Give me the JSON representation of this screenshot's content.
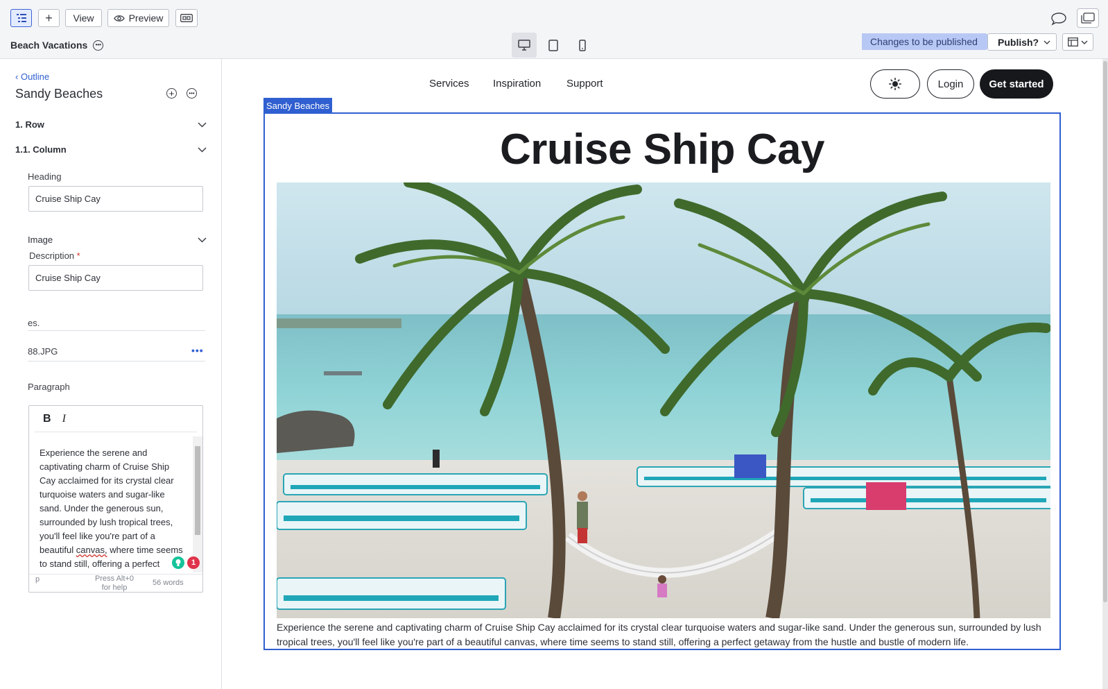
{
  "toolbar": {
    "view_label": "View",
    "preview_label": "Preview"
  },
  "site": {
    "title": "Beach Vacations"
  },
  "publish": {
    "status": "Changes to be published",
    "button_label": "Publish?"
  },
  "outline": {
    "back_label": "Outline",
    "title": "Sandy Beaches",
    "sections": [
      {
        "label": "1. Row"
      },
      {
        "label": "1.1. Column"
      }
    ]
  },
  "fields": {
    "heading_label": "Heading",
    "heading_value": "Cruise Ship Cay",
    "image_label": "Image",
    "description_label": "Description",
    "description_required": "*",
    "description_value": "Cruise Ship Cay",
    "images_partial": "‍es.",
    "file_name": "88.JPG",
    "file_more": "•••",
    "paragraph_label": "Paragraph",
    "bold_label": "B",
    "italic_label": "I",
    "paragraph_text_before": "Experience the serene and captivating charm of Cruise Ship Cay acclaimed for its crystal clear turquoise waters and sugar-like sand. Under the generous sun, surrounded by lush tropical trees, you'll feel like you're part of a beautiful ",
    "paragraph_text_flagged": "canvas,",
    "paragraph_text_after": " where time seems to stand still, offering a perfect getaway from the hustle",
    "editor_footer_p": "p",
    "editor_help": "Press Alt+0 for help",
    "word_count": "56 words",
    "grammarly_count": "1"
  },
  "preview": {
    "nav": [
      "Services",
      "Inspiration",
      "Support"
    ],
    "login_label": "Login",
    "cta_label": "Get started",
    "selection_tag": "Sandy Beaches",
    "heading": "Cruise Ship Cay",
    "description": "Experience the serene and captivating charm of Cruise Ship Cay acclaimed for its crystal clear turquoise waters and sugar-like sand. Under the generous sun, surrounded by lush tropical trees, you'll feel like you're part of a beautiful canvas, where time seems to stand still, offering a perfect getaway from the hustle and bustle of modern life."
  },
  "colors": {
    "accent": "#2f5fd0",
    "status_tag": "#b8c8f5",
    "cta": "#16181c"
  }
}
